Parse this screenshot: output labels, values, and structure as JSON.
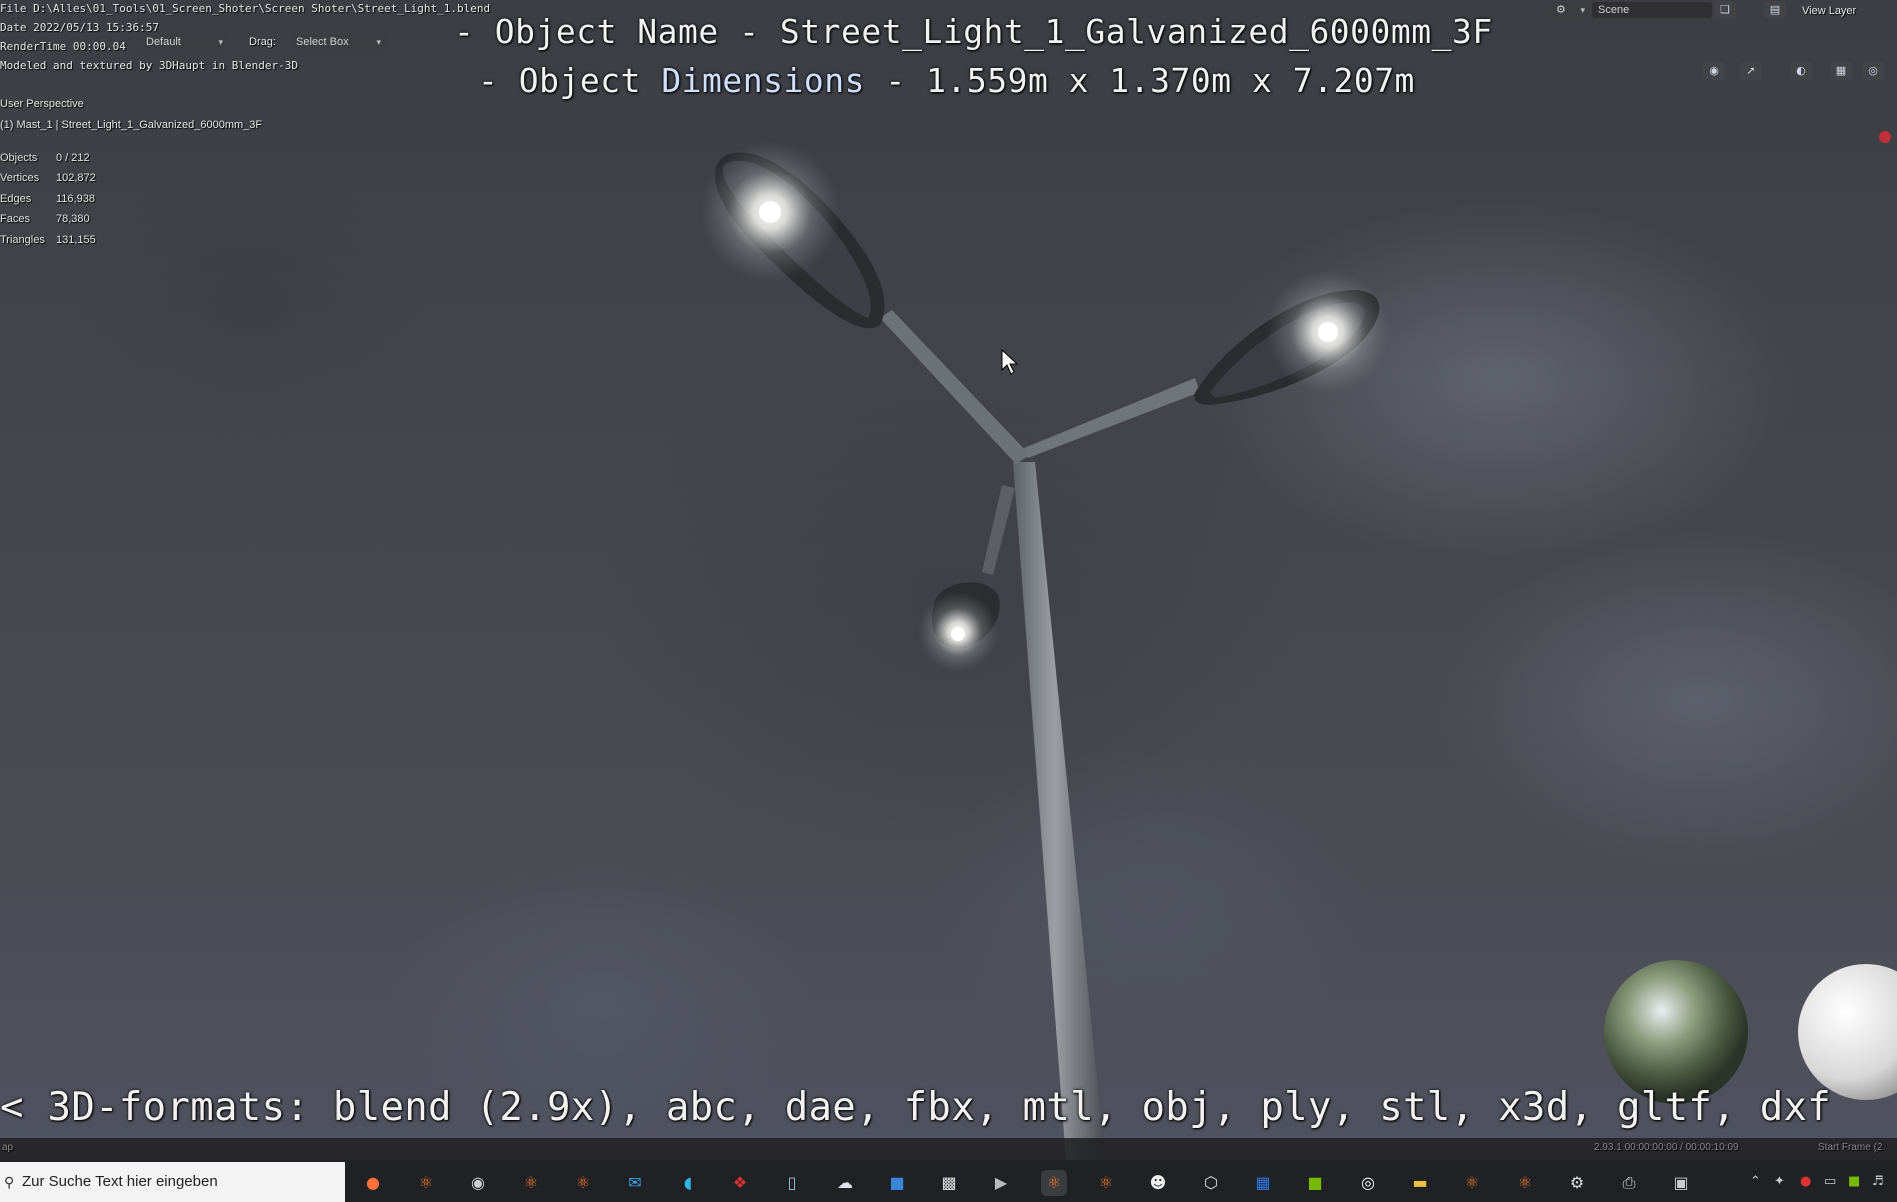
{
  "window": {
    "file_line": "File D:\\Alles\\01_Tools\\01_Screen_Shoter\\Screen Shoter\\Street_Light_1.blend",
    "date_line": "Date 2022/05/13 15:36:57",
    "render_time": "RenderTime 00:00.04",
    "credit": "Modeled and textured by 3DHaupt in Blender-3D"
  },
  "header": {
    "orientation_value": "Default",
    "drag_label": "Drag:",
    "drag_value": "Select Box",
    "scene_label": "Scene",
    "view_layer_label": "View Layer"
  },
  "overlay": {
    "object_name": "- Object Name - Street_Light_1_Galvanized_6000mm_3F",
    "object_dimensions_prefix": "- Object ",
    "object_dimensions_word": "Dimensions",
    "object_dimensions_value": " -  1.559m x 1.370m x 7.207m",
    "formats_line": "< 3D-formats: blend (2.9x), abc, dae, fbx, mtl, obj, ply, stl, x3d, gltf, dxf"
  },
  "viewport_info": {
    "perspective": "User Perspective",
    "active_object": "(1) Mast_1 | Street_Light_1_Galvanized_6000mm_3F"
  },
  "stats": [
    {
      "label": "Objects",
      "value": "0 / 212"
    },
    {
      "label": "Vertices",
      "value": "102,872"
    },
    {
      "label": "Edges",
      "value": "116,938"
    },
    {
      "label": "Faces",
      "value": "78,380"
    },
    {
      "label": "Triangles",
      "value": "131,155"
    }
  ],
  "status_bar": {
    "left": "ap",
    "version_time": "2.93.1   00:00:00:00 / 00:00:10:09",
    "start_frame": "Start Frame (2"
  },
  "taskbar": {
    "search_placeholder": "Zur Suche Text hier eingeben",
    "icons": [
      "firefox-icon",
      "blender-icon",
      "obs-icon",
      "blender-icon",
      "blender-icon",
      "mail-icon",
      "edge-icon",
      "app-red-icon",
      "app-notepad-icon",
      "app-cloud-icon",
      "app-blue-icon",
      "terminal-icon",
      "app-video-icon",
      "blender-icon",
      "blender-icon",
      "panda-icon",
      "cube-icon",
      "calendar-icon",
      "nvidia-icon",
      "app-circle-icon",
      "folder-icon",
      "blender-icon",
      "blender-icon",
      "settings-icon",
      "app-device-icon",
      "app-window-icon"
    ]
  },
  "colors": {
    "accent_blue": "#4a7fd4",
    "recording_dot": "#c0303a",
    "taskbar_bg": "#1f2124"
  }
}
